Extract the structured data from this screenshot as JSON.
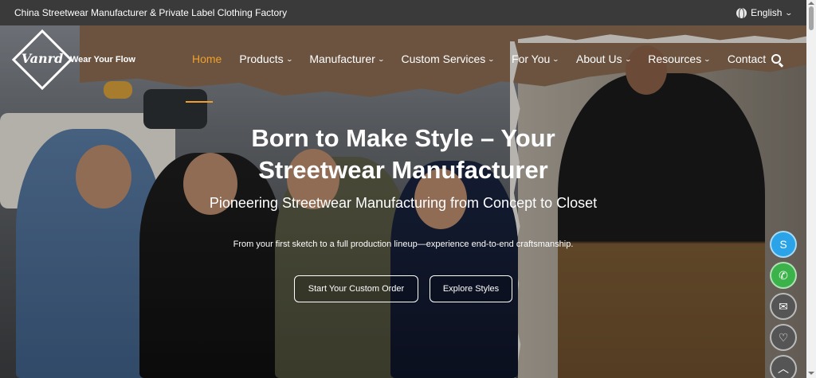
{
  "topbar": {
    "tagline": "China Streetwear Manufacturer & Private Label Clothing Factory",
    "language": "English"
  },
  "brand": {
    "logo_text": "Vanrd",
    "slogan": "Wear Your Flow"
  },
  "nav": {
    "items": [
      {
        "label": "Home",
        "active": true
      },
      {
        "label": "Products",
        "dropdown": true
      },
      {
        "label": "Manufacturer",
        "dropdown": true
      },
      {
        "label": "Custom Services",
        "dropdown": true
      },
      {
        "label": "For You",
        "dropdown": true
      },
      {
        "label": "About Us",
        "dropdown": true
      },
      {
        "label": "Resources",
        "dropdown": true
      },
      {
        "label": "Contact"
      }
    ]
  },
  "hero": {
    "headline": "Born to Make Style – Your Streetwear Manufacturer",
    "subheadline": "Pioneering Streetwear Manufacturing from Concept to Closet",
    "description": "From your first sketch to a full production lineup—experience end-to-end craftsmanship.",
    "cta_primary": "Start Your Custom Order",
    "cta_secondary": "Explore Styles"
  },
  "floating_contacts": [
    "skype-icon",
    "whatsapp-icon",
    "email-icon",
    "heart-icon",
    "arrow-up-icon"
  ],
  "colors": {
    "accent": "#f0a02a",
    "topbar_bg": "#3a3a3a",
    "skype": "#2aa3e8",
    "whatsapp": "#3cb34a"
  }
}
